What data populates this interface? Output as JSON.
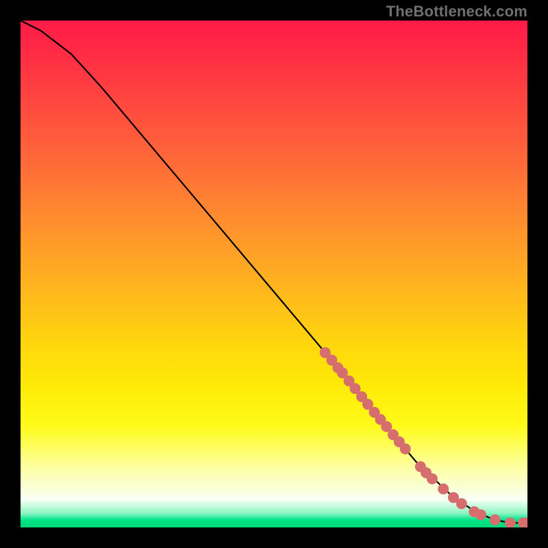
{
  "attribution": "TheBottleneck.com",
  "chart_data": {
    "type": "line",
    "title": "",
    "xlabel": "",
    "ylabel": "",
    "xlim": [
      0,
      100
    ],
    "ylim": [
      0,
      100
    ],
    "curve": [
      {
        "x": 0.0,
        "y": 100.0
      },
      {
        "x": 4.0,
        "y": 98.0
      },
      {
        "x": 10.0,
        "y": 93.4
      },
      {
        "x": 16.0,
        "y": 86.8
      },
      {
        "x": 60.0,
        "y": 34.6
      },
      {
        "x": 70.0,
        "y": 22.5
      },
      {
        "x": 78.0,
        "y": 13.0
      },
      {
        "x": 85.0,
        "y": 6.3
      },
      {
        "x": 90.0,
        "y": 2.9
      },
      {
        "x": 93.6,
        "y": 1.5
      },
      {
        "x": 96.6,
        "y": 0.9
      },
      {
        "x": 100.0,
        "y": 0.9
      }
    ],
    "markers": {
      "color": "#d76e6e",
      "radius_px": 8,
      "points": [
        {
          "x": 60.1,
          "y": 34.5
        },
        {
          "x": 61.4,
          "y": 33.0
        },
        {
          "x": 62.6,
          "y": 31.5
        },
        {
          "x": 63.5,
          "y": 30.5
        },
        {
          "x": 64.8,
          "y": 28.9
        },
        {
          "x": 66.0,
          "y": 27.4
        },
        {
          "x": 67.3,
          "y": 25.8
        },
        {
          "x": 68.5,
          "y": 24.3
        },
        {
          "x": 69.8,
          "y": 22.7
        },
        {
          "x": 71.0,
          "y": 21.3
        },
        {
          "x": 72.2,
          "y": 19.9
        },
        {
          "x": 73.5,
          "y": 18.3
        },
        {
          "x": 74.7,
          "y": 16.9
        },
        {
          "x": 75.9,
          "y": 15.5
        },
        {
          "x": 78.9,
          "y": 12.0
        },
        {
          "x": 80.0,
          "y": 10.8
        },
        {
          "x": 81.2,
          "y": 9.6
        },
        {
          "x": 83.4,
          "y": 7.6
        },
        {
          "x": 85.4,
          "y": 5.9
        },
        {
          "x": 87.0,
          "y": 4.7
        },
        {
          "x": 89.5,
          "y": 3.1
        },
        {
          "x": 90.8,
          "y": 2.5
        },
        {
          "x": 93.6,
          "y": 1.5
        },
        {
          "x": 96.6,
          "y": 0.9
        },
        {
          "x": 99.2,
          "y": 0.9
        },
        {
          "x": 100.0,
          "y": 0.9
        }
      ]
    }
  }
}
